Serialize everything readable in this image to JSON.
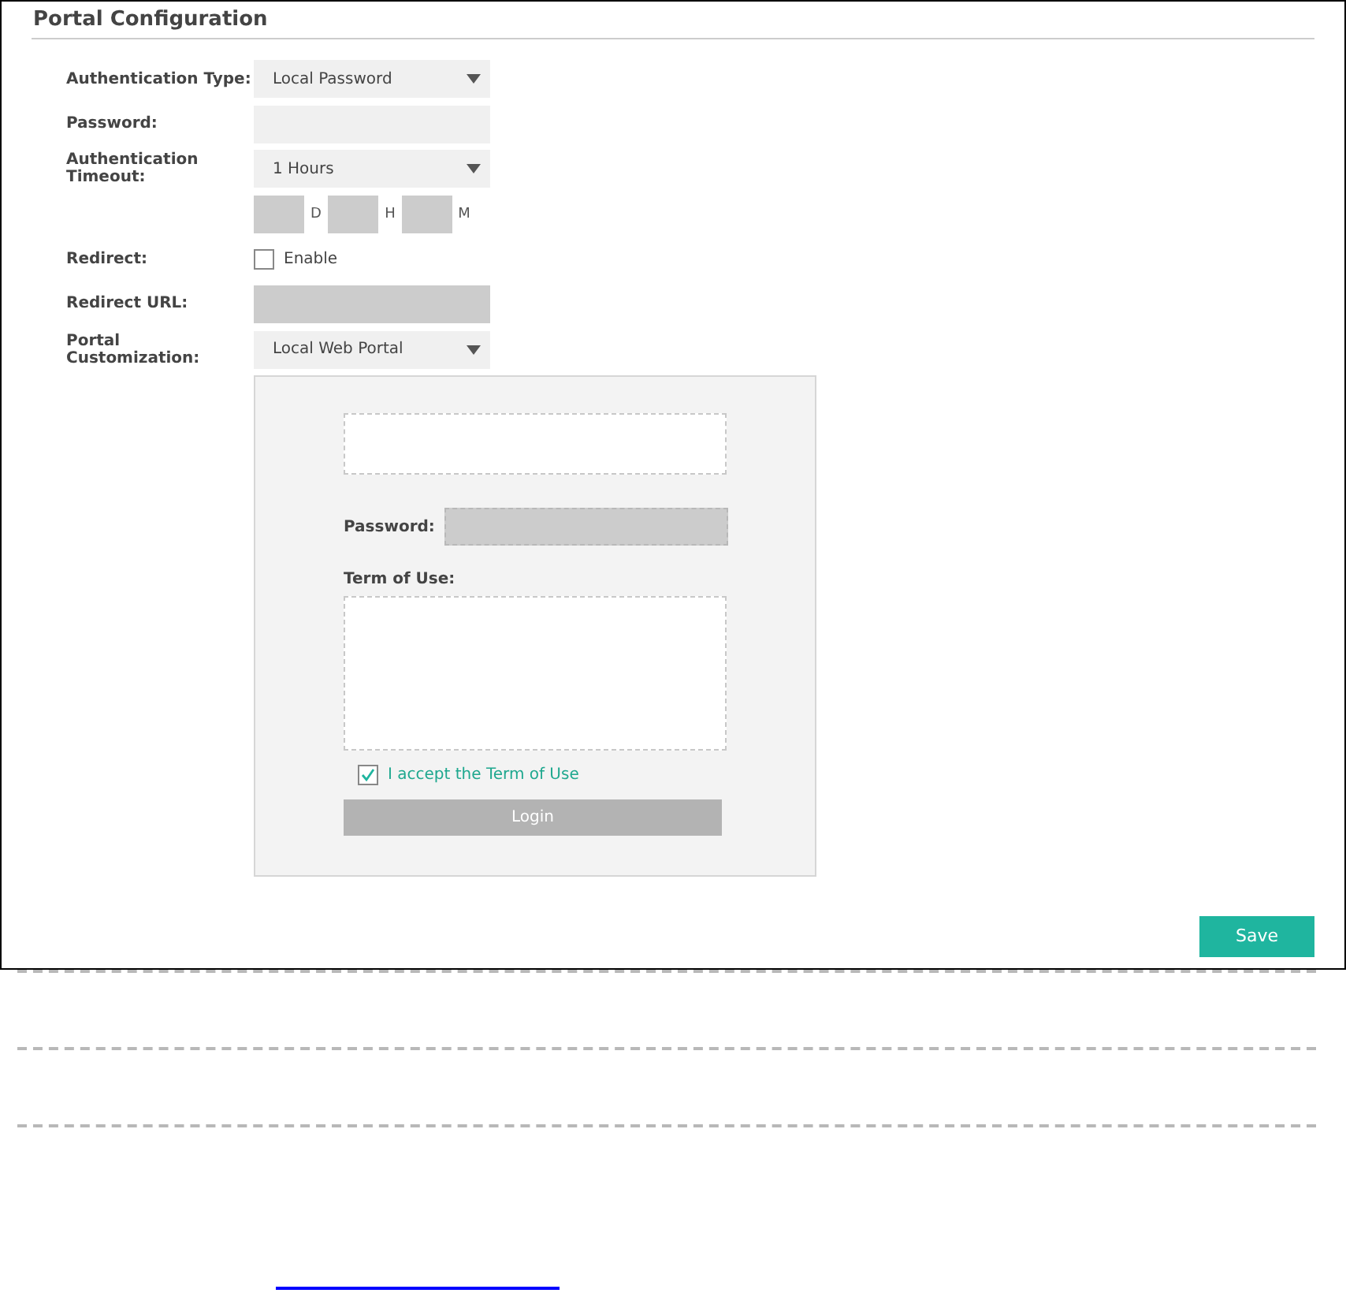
{
  "title": "Portal Configuration",
  "fields": [
    {
      "kind": "select",
      "label": "Authentication Type:",
      "value": "Local Password"
    },
    {
      "kind": "input",
      "label": "Password:",
      "disabled": false
    },
    {
      "kind": "select",
      "label": "Authentication Timeout:",
      "value": "1 Hours"
    },
    {
      "kind": "duration",
      "units": [
        "D",
        "H",
        "M"
      ]
    },
    {
      "kind": "checkbox",
      "label": "Redirect:",
      "option": "Enable",
      "checked": false
    },
    {
      "kind": "input",
      "label": "Redirect URL:",
      "disabled": true
    },
    {
      "kind": "select",
      "label": "Portal Customization:",
      "value": "Local Web Portal"
    }
  ],
  "preview": {
    "password_label": "Password:",
    "terms_label": "Term of Use:",
    "accept": {
      "label": "I accept the Term of Use",
      "checked": true
    },
    "login": "Login"
  },
  "save": "Save"
}
